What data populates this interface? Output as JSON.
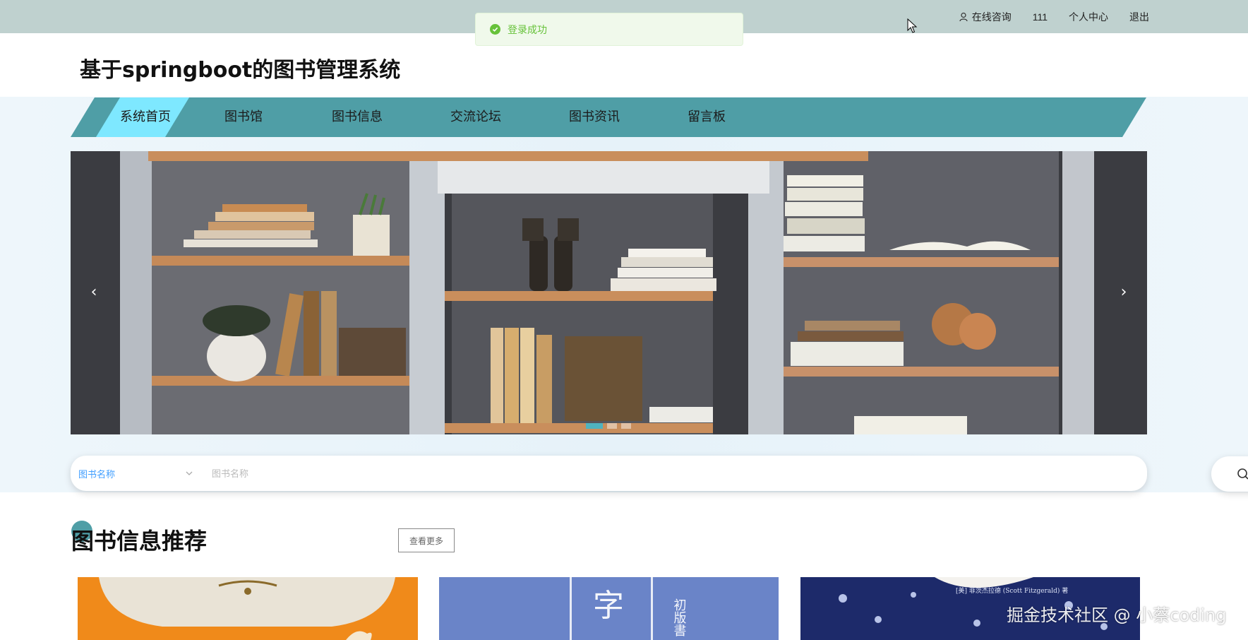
{
  "topbar": {
    "consult": "在线咨询",
    "username": "111",
    "profile": "个人中心",
    "logout": "退出"
  },
  "toast": {
    "message": "登录成功"
  },
  "site": {
    "title": "基于springboot的图书管理系统"
  },
  "nav": {
    "items": [
      {
        "label": "系统首页"
      },
      {
        "label": "图书馆"
      },
      {
        "label": "图书信息"
      },
      {
        "label": "交流论坛"
      },
      {
        "label": "图书资讯"
      },
      {
        "label": "留言板"
      }
    ]
  },
  "banner": {
    "prev": "‹",
    "next": "›"
  },
  "search": {
    "field_selected": "图书名称",
    "placeholder": "图书名称"
  },
  "section": {
    "title": "图书信息推荐",
    "more": "查看更多"
  },
  "books": [
    {
      "cover_text": ""
    },
    {
      "cover_text": "字"
    },
    {
      "cover_text": "[美] 菲茨杰拉德 (Scott Fitzgerald) 著"
    }
  ],
  "watermark": "掘金技术社区 @ 小蔡coding",
  "colors": {
    "nav_bg": "#4f9ea6",
    "nav_active": "#7ee8ff",
    "topbar": "#bfd1cf",
    "success": "#67c23a"
  }
}
